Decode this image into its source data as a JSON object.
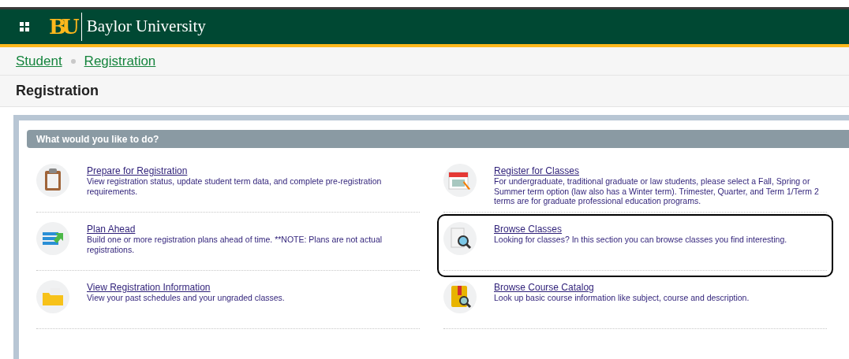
{
  "header": {
    "brand": "Baylor University",
    "logo": "BU"
  },
  "breadcrumb": [
    "Student",
    "Registration"
  ],
  "page_title": "Registration",
  "panel": {
    "title": "What would you like to do?",
    "columns": [
      [
        {
          "title": "Prepare for Registration",
          "description": "View registration status, update student term data, and complete pre-registration requirements.",
          "highlighted": false
        },
        {
          "title": "Plan Ahead",
          "description": "Build one or more registration plans ahead of time. **NOTE: Plans are not actual registrations.",
          "highlighted": false
        },
        {
          "title": "View Registration Information",
          "description": "View your past schedules and your ungraded classes.",
          "highlighted": false
        }
      ],
      [
        {
          "title": "Register for Classes",
          "description": "For undergraduate, traditional graduate or law students, please select a Fall, Spring or Summer term option (law also has a Winter term). Trimester, Quarter, and Term 1/Term 2 terms are for graduate professional education programs.",
          "highlighted": false
        },
        {
          "title": "Browse Classes",
          "description": "Looking for classes? In this section you can browse classes you find interesting.",
          "highlighted": true
        },
        {
          "title": "Browse Course Catalog",
          "description": "Look up basic course information like subject, course and description.",
          "highlighted": false
        }
      ]
    ]
  }
}
